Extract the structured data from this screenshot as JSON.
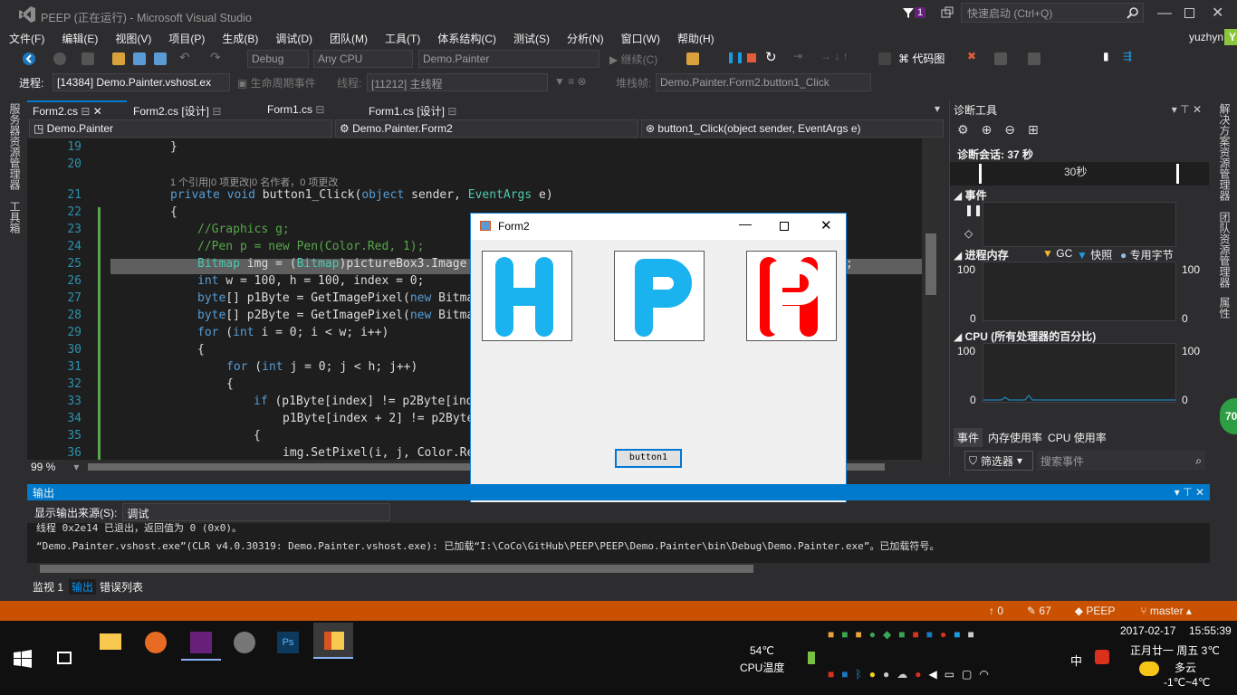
{
  "window": {
    "title": "PEEP (正在运行) - Microsoft Visual Studio",
    "quick_launch": "快速启动 (Ctrl+Q)",
    "user": "yuzhyn",
    "user_initial": "Y",
    "notify_count": "1"
  },
  "menu": [
    "文件(F)",
    "编辑(E)",
    "视图(V)",
    "项目(P)",
    "生成(B)",
    "调试(D)",
    "团队(M)",
    "工具(T)",
    "体系结构(C)",
    "测试(S)",
    "分析(N)",
    "窗口(W)",
    "帮助(H)"
  ],
  "toolbar": {
    "config": "Debug",
    "platform": "Any CPU",
    "startup": "Demo.Painter",
    "continue": "继续(C)",
    "codemap": "代码图"
  },
  "debugbar": {
    "process_label": "进程:",
    "process": "[14384] Demo.Painter.vshost.ex",
    "lifecycle": "生命周期事件",
    "thread_label": "线程:",
    "thread": "[11212] 主线程",
    "stack_label": "堆栈帧:",
    "stack": "Demo.Painter.Form2.button1_Click"
  },
  "left_tabs": [
    "服务器资源管理器",
    "工具箱"
  ],
  "right_tabs": [
    "解决方案资源管理器",
    "团队资源管理器",
    "属性"
  ],
  "doc_tabs": [
    "Form2.cs",
    "Form2.cs [设计]",
    "Form1.cs",
    "Form1.cs [设计]"
  ],
  "nav": {
    "project": "Demo.Painter",
    "class": "Demo.Painter.Form2",
    "member": "button1_Click(object sender, EventArgs e)"
  },
  "editor": {
    "zoom": "99 %",
    "lens": "1 个引用|0 项更改|0 名作者，0 项更改"
  },
  "form2": {
    "title": "Form2",
    "button": "button1"
  },
  "diag": {
    "title": "诊断工具",
    "session": "诊断会话: 37 秒",
    "timeline": "30秒",
    "events": "事件",
    "memory": "进程内存",
    "gc": "GC",
    "snapshot": "快照",
    "private": "专用字节",
    "cpu": "CPU (所有处理器的百分比)",
    "mem_max": "100",
    "mem_min": "0",
    "cpu_max": "100",
    "cpu_min": "0",
    "tabs": [
      "事件",
      "内存使用率",
      "CPU 使用率"
    ],
    "filter": "筛选器",
    "search_placeholder": "搜索事件"
  },
  "output": {
    "title": "输出",
    "source_label": "显示输出来源(S):",
    "source": "调试",
    "lines": [
      "线程 0x2e14 已退出，返回值为 0 (0x0)。",
      "“Demo.Painter.vshost.exe”(CLR v4.0.30319: Demo.Painter.vshost.exe): 已加载“I:\\CoCo\\GitHub\\PEEP\\PEEP\\Demo.Painter\\bin\\Debug\\Demo.Painter.exe”。已加载符号。"
    ]
  },
  "bottom_tabs": [
    "监视 1",
    "输出",
    "错误列表"
  ],
  "status": {
    "up": "0",
    "edits": "67",
    "repo": "PEEP",
    "branch": "master"
  },
  "taskbar": {
    "temp": "54℃",
    "temp_label": "CPU温度",
    "date": "2017-02-17",
    "time": "15:55:39",
    "lunar": "正月廿一 周五 3℃",
    "weather": "多云",
    "range": "-1℃~4℃",
    "ime": "中",
    "badge": "70"
  }
}
